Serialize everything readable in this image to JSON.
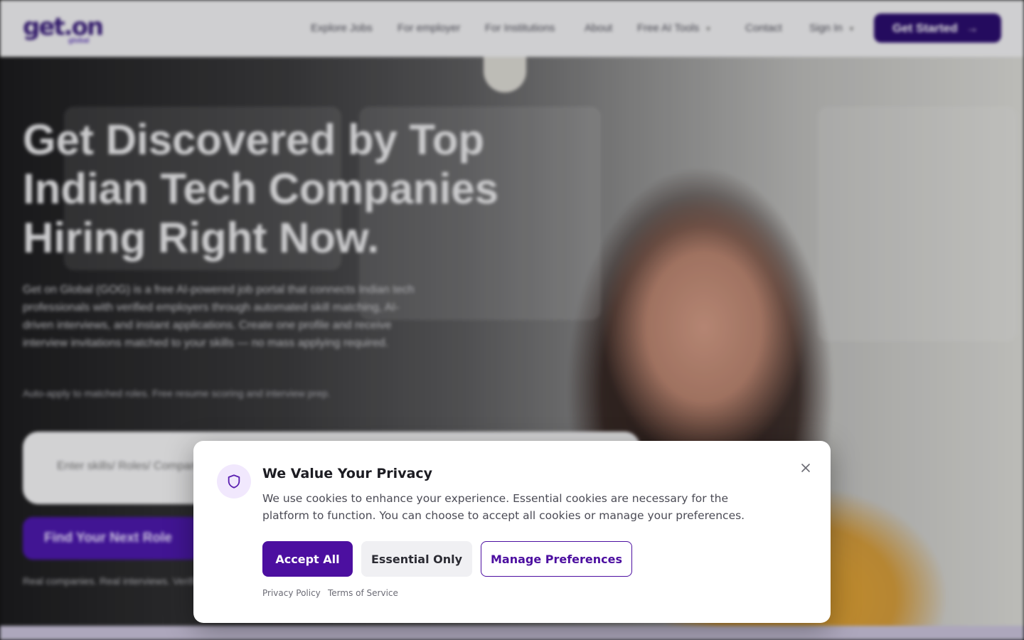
{
  "header": {
    "logo_text": "get.on",
    "logo_sub": "global",
    "nav": [
      {
        "label": "Explore Jobs"
      },
      {
        "label": "For employer"
      },
      {
        "label": "For Institutions"
      },
      {
        "label": "About"
      },
      {
        "label": "Free AI Tools"
      },
      {
        "label": "Contact"
      },
      {
        "label": "Sign In"
      }
    ],
    "cta_label": "Get Started",
    "cta_arrow": "→"
  },
  "hero": {
    "title": "Get Discovered by Top Indian Tech Companies Hiring Right Now.",
    "description": "Get on Global (GOG) is a free AI-powered job portal that connects Indian tech professionals with verified employers through automated skill matching, AI-driven interviews, and instant applications. Create one profile and receive interview invitations matched to your skills — no mass applying required.",
    "note": "Auto-apply to matched roles. Free resume scoring and interview prep.",
    "search_placeholder": "Enter skills/ Roles/ Companies",
    "find_label": "Find Your Next Role",
    "footnote": "Real companies. Real interviews. Verified jobs."
  },
  "cookie_modal": {
    "title": "We Value Your Privacy",
    "body": "We use cookies to enhance your experience. Essential cookies are necessary for the platform to function. You can choose to accept all cookies or manage your preferences.",
    "accept_label": "Accept All",
    "essential_label": "Essential Only",
    "manage_label": "Manage Preferences",
    "privacy_link": "Privacy Policy",
    "terms_link": "Terms of Service",
    "icon": "shield-icon",
    "accent_color": "#4c0fa0"
  }
}
